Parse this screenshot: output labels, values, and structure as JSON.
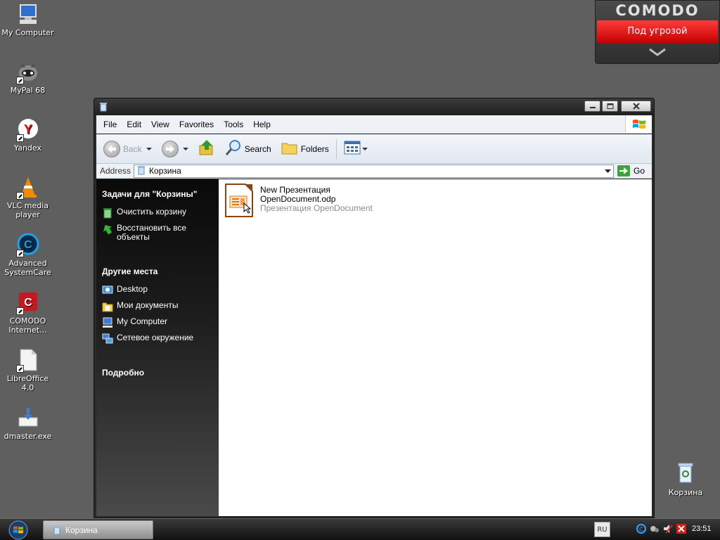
{
  "desktop": {
    "icons": [
      {
        "label": "My Computer"
      },
      {
        "label": "MyPal 68"
      },
      {
        "label": "Yandex"
      },
      {
        "label": "VLC media player"
      },
      {
        "label": "Advanced SystemCare"
      },
      {
        "label": "COMODO Internet..."
      },
      {
        "label": "LibreOffice 4.0"
      },
      {
        "label": "dmaster.exe"
      }
    ],
    "recycle_bin_label": "Корзина"
  },
  "comodo_widget": {
    "brand": "COMODO",
    "status": "Под угрозой",
    "status_color": "#e01010"
  },
  "window": {
    "menu": [
      "File",
      "Edit",
      "View",
      "Favorites",
      "Tools",
      "Help"
    ],
    "toolbar": {
      "back": "Back",
      "search": "Search",
      "folders": "Folders"
    },
    "address": {
      "label": "Address",
      "value": "Корзина",
      "go": "Go"
    },
    "taskpane": {
      "tasks_header": "Задачи для \"Корзины\"",
      "tasks": [
        {
          "label": "Очистить корзину",
          "icon": "empty-bin-icon"
        },
        {
          "label": "Восстановить все объекты",
          "icon": "restore-icon"
        }
      ],
      "places_header": "Другие места",
      "places": [
        {
          "label": "Desktop",
          "icon": "desktop-icon"
        },
        {
          "label": "Мои документы",
          "icon": "documents-icon"
        },
        {
          "label": "My Computer",
          "icon": "computer-icon"
        },
        {
          "label": "Сетевое окружение",
          "icon": "network-icon"
        }
      ],
      "details_header": "Подробно"
    },
    "files": [
      {
        "name_line1": "New Презентация",
        "name_line2": "OpenDocument.odp",
        "type": "Презентация OpenDocument"
      }
    ]
  },
  "taskbar": {
    "task_label": "Корзина",
    "language": "RU",
    "clock": "23:51"
  }
}
